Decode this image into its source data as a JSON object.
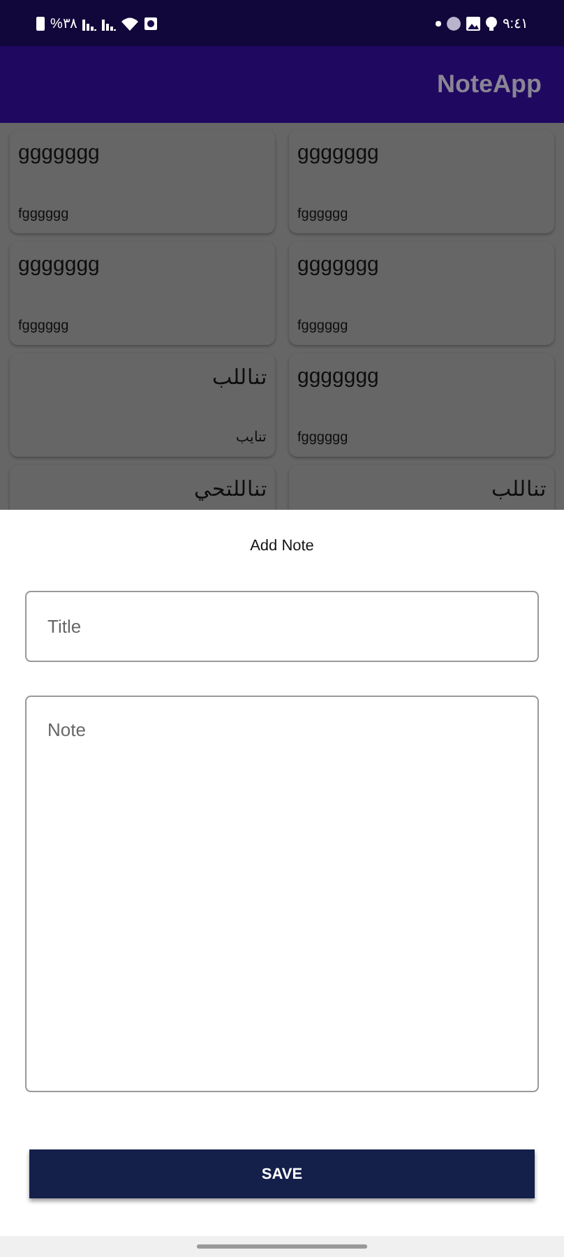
{
  "status_bar": {
    "battery": "%٣٨",
    "time": "٩:٤١"
  },
  "app_bar": {
    "title": "NoteApp"
  },
  "notes": [
    {
      "title": "ggggggg",
      "body": "fgggggg",
      "rtl": false
    },
    {
      "title": "ggggggg",
      "body": "fgggggg",
      "rtl": false
    },
    {
      "title": "ggggggg",
      "body": "fgggggg",
      "rtl": false
    },
    {
      "title": "ggggggg",
      "body": "fgggggg",
      "rtl": false
    },
    {
      "title": "تناللب",
      "body": "تنايب",
      "rtl": true
    },
    {
      "title": "ggggggg",
      "body": "fgggggg",
      "rtl": false
    },
    {
      "title": "تناللتحي",
      "rtl": true
    },
    {
      "title": "تناللب",
      "rtl": true
    }
  ],
  "sheet": {
    "heading": "Add Note",
    "title_field": {
      "placeholder": "Title"
    },
    "note_field": {
      "placeholder": "Note"
    },
    "save_button": "SAVE"
  }
}
